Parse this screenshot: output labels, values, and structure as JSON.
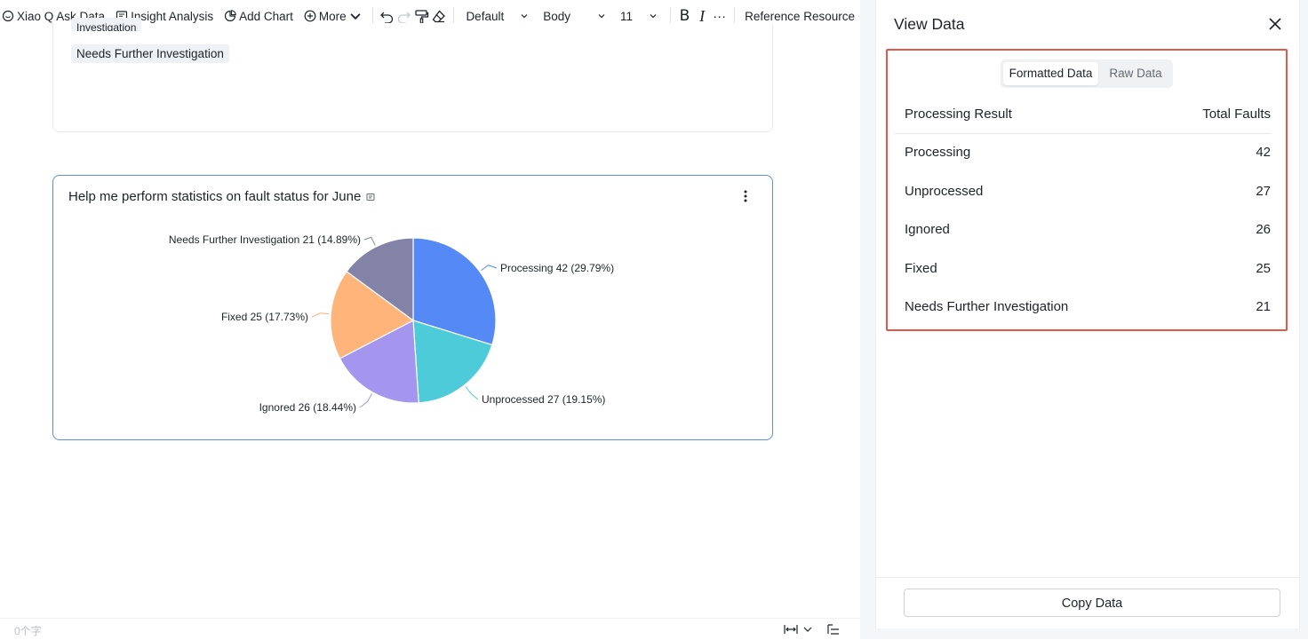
{
  "toolbar": {
    "items": [
      {
        "label": "Xiao Q Ask Data",
        "icon": "ask-data-icon"
      },
      {
        "label": "Insight Analysis",
        "icon": "insight-icon"
      },
      {
        "label": "Add Chart",
        "icon": "chart-icon"
      },
      {
        "label": "More",
        "icon": "plus-circle-icon"
      }
    ],
    "style_select": "Default",
    "paragraph_select": "Body",
    "font_size": "11",
    "bold_label": "B",
    "italic_label": "I",
    "more_label": "···",
    "reference_label": "Reference Resource"
  },
  "doc": {
    "tag_partial": "Investigation",
    "tag_label": "Needs Further Investigation",
    "chart_title": "Help me perform statistics on fault status for June"
  },
  "chart_data": {
    "type": "pie",
    "title": "Help me perform statistics on fault status for June",
    "slices": [
      {
        "name": "Processing",
        "value": 42,
        "percent": "29.79%",
        "color": "#5589f5"
      },
      {
        "name": "Unprocessed",
        "value": 27,
        "percent": "19.15%",
        "color": "#4ecbd8"
      },
      {
        "name": "Ignored",
        "value": 26,
        "percent": "18.44%",
        "color": "#a495ef"
      },
      {
        "name": "Fixed",
        "value": 25,
        "percent": "17.73%",
        "color": "#ffb57a"
      },
      {
        "name": "Needs Further Investigation",
        "value": 21,
        "percent": "14.89%",
        "color": "#8283a6"
      }
    ],
    "labels": [
      "Processing 42 (29.79%)",
      "Unprocessed 27 (19.15%)",
      "Ignored 26 (18.44%)",
      "Fixed 25 (17.73%)",
      "Needs Further Investigation 21 (14.89%)"
    ]
  },
  "status": {
    "word_count": "0个字"
  },
  "panel": {
    "title": "View Data",
    "tabs": [
      "Formatted Data",
      "Raw Data"
    ],
    "active_tab": "Formatted Data",
    "columns": [
      "Processing Result",
      "Total Faults"
    ],
    "rows": [
      {
        "result": "Processing",
        "total": "42"
      },
      {
        "result": "Unprocessed",
        "total": "27"
      },
      {
        "result": "Ignored",
        "total": "26"
      },
      {
        "result": "Fixed",
        "total": "25"
      },
      {
        "result": "Needs Further Investigation",
        "total": "21"
      }
    ],
    "copy_label": "Copy Data",
    "highlight_color": "#e4584b"
  }
}
